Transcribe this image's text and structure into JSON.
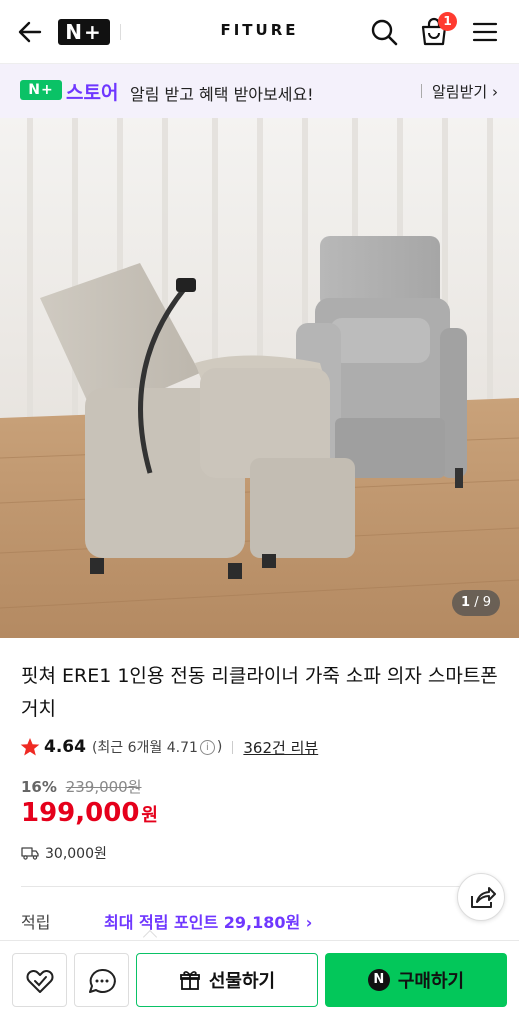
{
  "header": {
    "back_icon": "arrow-left-icon",
    "np_logo": "N+",
    "brand": "FITURE",
    "search_icon": "search-icon",
    "cart_icon": "shopping-bag-icon",
    "cart_badge": "1",
    "menu_icon": "hamburger-menu-icon"
  },
  "store_banner": {
    "logo": "N+",
    "store_name": "스토어",
    "message": "알림 받고 혜택 받아보세요!",
    "link": "알림받기 ›",
    "accent": "#6f37ff",
    "logo_color": "#0ac266"
  },
  "product": {
    "image_counter_current": "1",
    "image_counter_total": "/ 9",
    "title": "핏쳐 ERE1 1인용 전동 리클라이너 가죽 소파 의자 스마트폰거치",
    "rating": "4.64",
    "rating_recent": "(최근 6개월 4.71",
    "rating_recent_close": ")",
    "review_count": "362건 리뷰",
    "discount_rate": "16%",
    "original_price": "239,000원",
    "price": "199,000",
    "currency": "원",
    "shipping": "30,000원",
    "points_label": "적립",
    "points_value": "최대 적립 포인트 29,180원 ›",
    "price_color": "#e5001b"
  },
  "bottom_bar": {
    "wishlist_icon": "heart-check-icon",
    "chat_icon": "chat-bubble-icon",
    "gift_label": "선물하기",
    "buy_label": "구매하기",
    "buy_color": "#03c75a"
  }
}
